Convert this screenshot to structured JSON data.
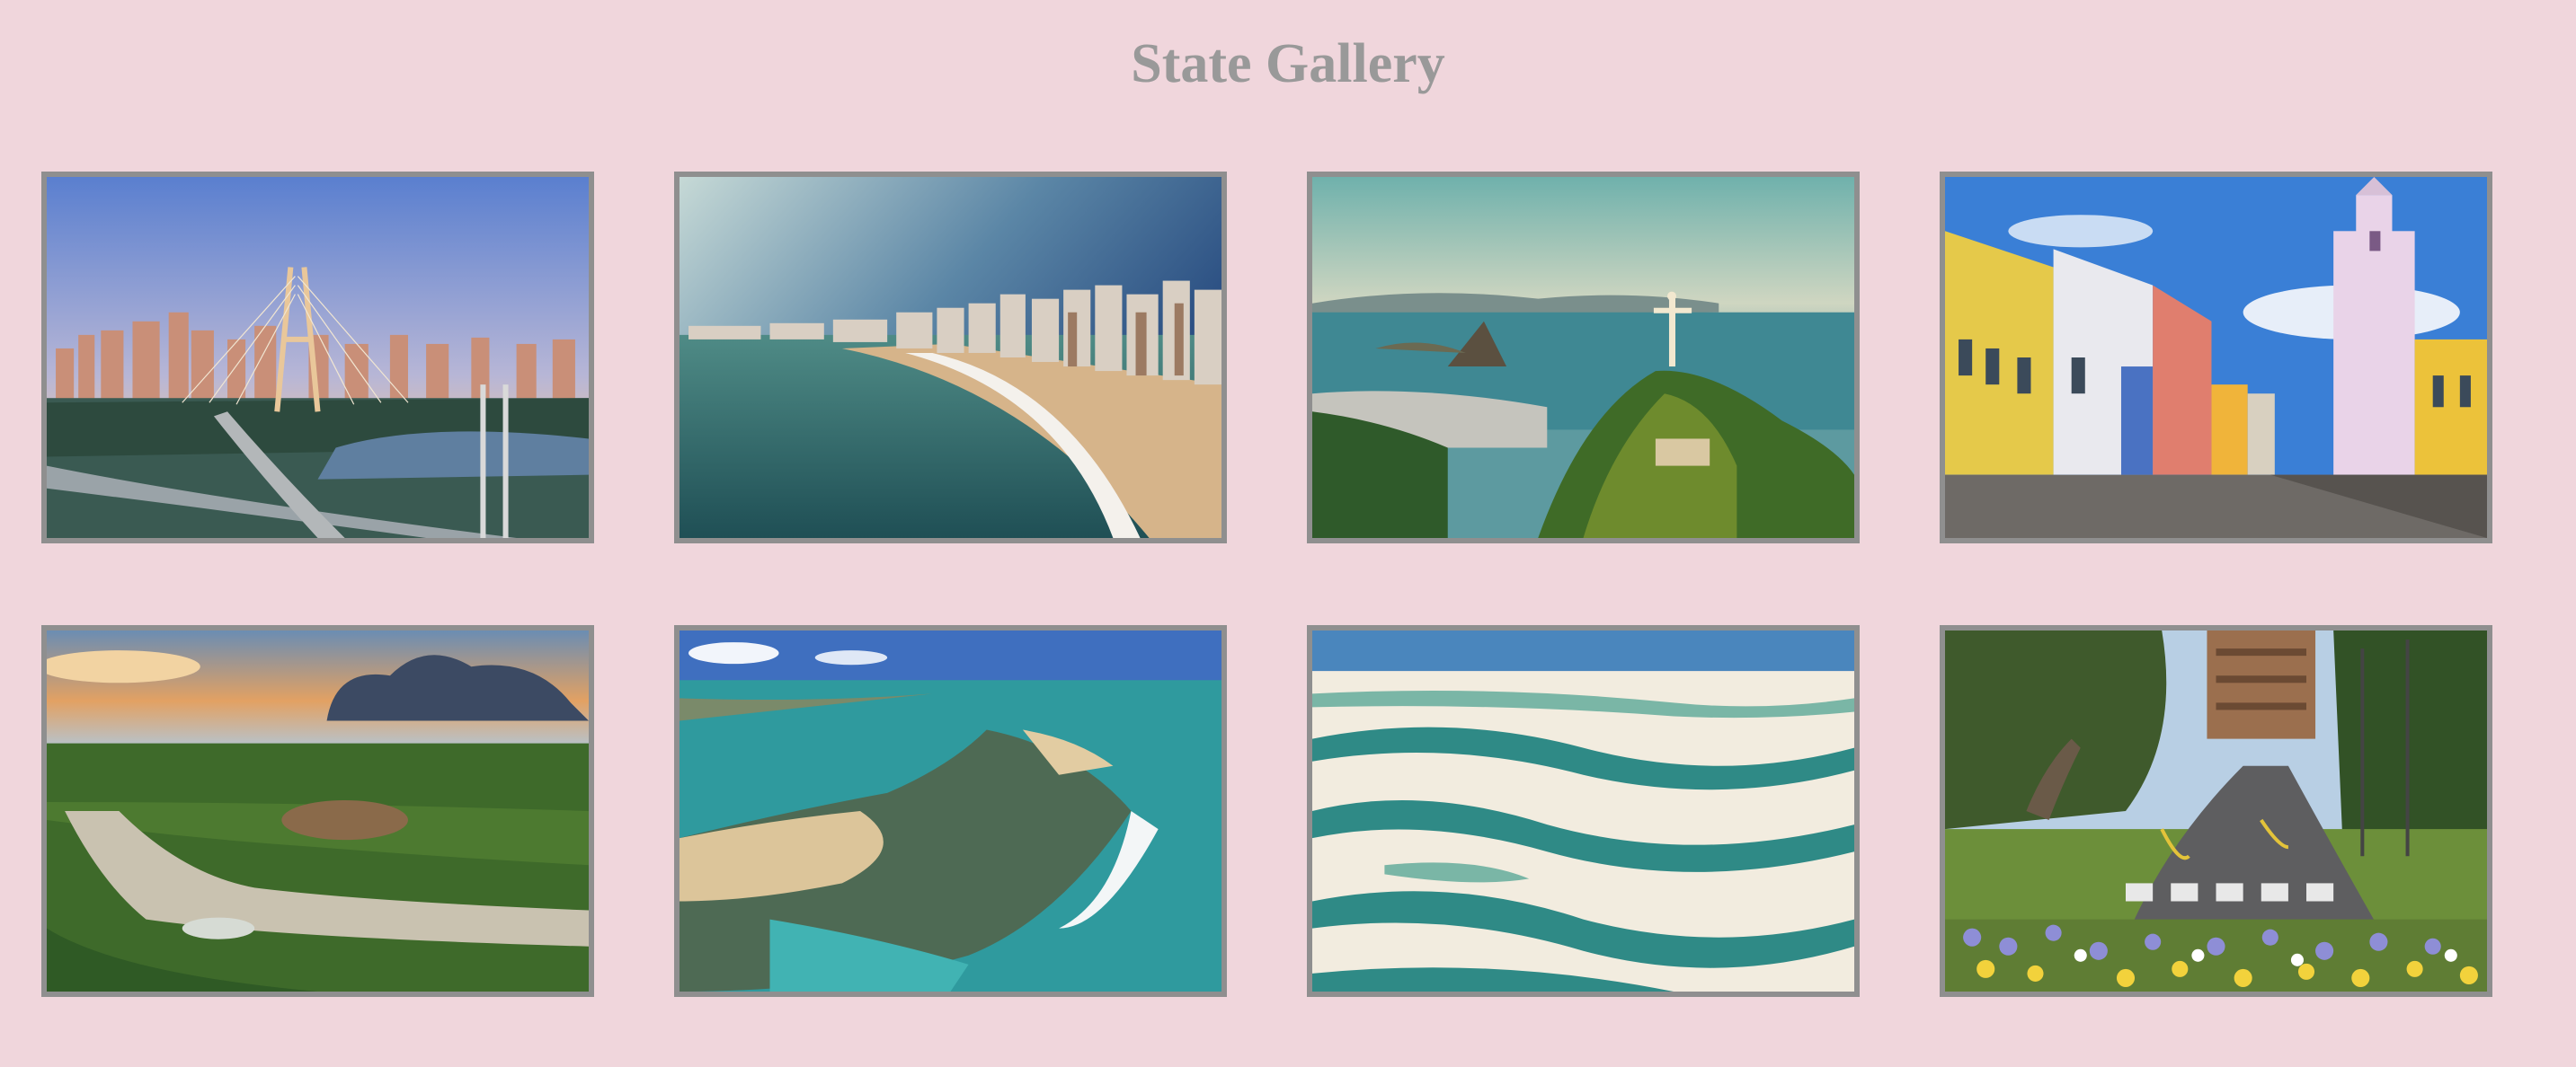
{
  "page": {
    "title": "State Gallery",
    "background": "#f0d6dc",
    "title_color": "#999999",
    "frame_color": "#8f8f8f"
  },
  "gallery": {
    "images": [
      {
        "subject": "city-skyline-cable-bridge"
      },
      {
        "subject": "beach-shoreline-high-rises"
      },
      {
        "subject": "christ-statue-bay-view"
      },
      {
        "subject": "colonial-colorful-street"
      },
      {
        "subject": "wetland-river-sunset"
      },
      {
        "subject": "coral-reef-coastline"
      },
      {
        "subject": "white-dunes-lagoons"
      },
      {
        "subject": "tree-lined-street-flowers"
      }
    ]
  }
}
